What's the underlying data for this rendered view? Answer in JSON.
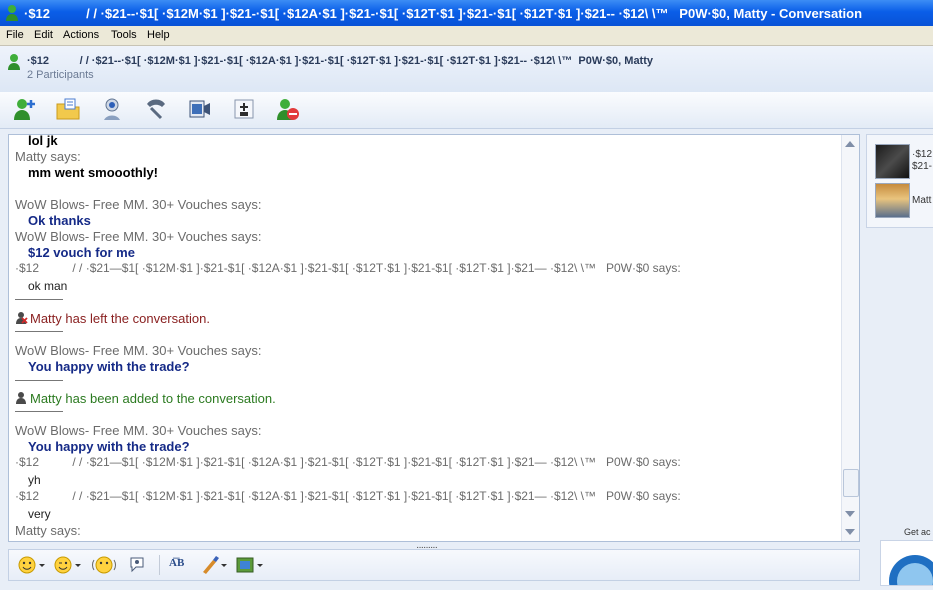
{
  "window": {
    "title": "·$12          / / ·$21--·$1[ ·$12M·$1 ]·$21-·$1[ ·$12A·$1 ]·$21-·$1[ ·$12T·$1 ]·$21-·$1[ ·$12T·$1 ]·$21-- ·$12\\ \\™   P0W·$0, Matty - Conversation"
  },
  "menu": [
    "File",
    "Edit",
    "Actions",
    "Tools",
    "Help"
  ],
  "header": {
    "name": "·$12          / / ·$21--·$1[ ·$12M·$1 ]·$21-·$1[ ·$12A·$1 ]·$21-·$1[ ·$12T·$1 ]·$21-·$1[ ·$12T·$1 ]·$21-- ·$12\\ \\™  P0W·$0, Matty",
    "participants": "2 Participants"
  },
  "toolbar": [
    "invite-contact",
    "send-files",
    "video-call",
    "phone-call",
    "video-clip",
    "games",
    "block-contact"
  ],
  "chat": {
    "l1": "lol jk",
    "l2": "Matty says:",
    "l3": "mm went smooothly!",
    "l4": "WoW Blows- Free MM. 30+ Vouches says:",
    "l5": "Ok thanks",
    "l6": "WoW Blows- Free MM. 30+ Vouches says:",
    "l7": "$12 vouch for me",
    "l8": "·$12          / / ·$21—$1[ ·$12M·$1 ]·$21-$1[ ·$12A·$1 ]·$21-$1[ ·$12T·$1 ]·$21-$1[ ·$12T·$1 ]·$21— ·$12\\ \\™   P0W·$0 says:",
    "l9": "ok man",
    "l10": "Matty has left the conversation.",
    "l11": "WoW Blows- Free MM. 30+ Vouches says:",
    "l12": "You happy with the trade?",
    "l13": "Matty has been added to the conversation.",
    "l14": "WoW Blows- Free MM. 30+ Vouches says:",
    "l15": "You happy with the trade?",
    "l16": "·$12          / / ·$21—$1[ ·$12M·$1 ]·$21-$1[ ·$12A·$1 ]·$21-$1[ ·$12T·$1 ]·$21-$1[ ·$12T·$1 ]·$21— ·$12\\ \\™   P0W·$0 says:",
    "l17": "yh",
    "l18": "·$12          / / ·$21—$1[ ·$12M·$1 ]·$21-$1[ ·$12A·$1 ]·$21-$1[ ·$12T·$1 ]·$21-$1[ ·$12T·$1 ]·$21— ·$12\\ \\™   P0W·$0 says:",
    "l19": "very",
    "l20": "Matty says:"
  },
  "bottom_toolbar": {
    "text_button": "A͞B"
  },
  "participants": [
    {
      "name": "·$12\n$21-"
    },
    {
      "name": "Matt"
    }
  ],
  "ad": {
    "text": "Get ac"
  },
  "grip": "·········"
}
